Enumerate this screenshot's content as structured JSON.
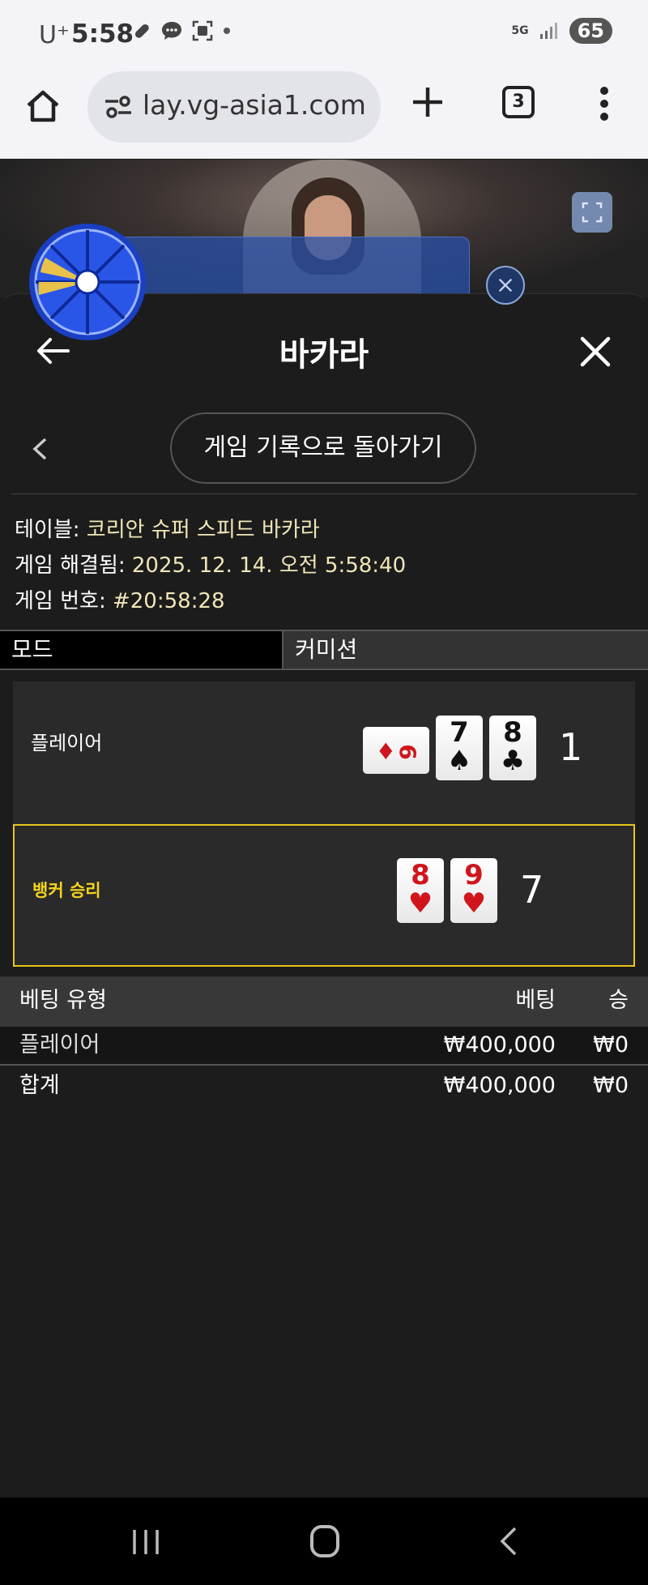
{
  "status_bar": {
    "carrier": "U⁺",
    "time": "5:58",
    "network": "5G",
    "battery": "65"
  },
  "browser": {
    "url": "lay.vg-asia1.com",
    "tab_count": "3"
  },
  "panel": {
    "title": "바카라",
    "back_to_history_label": "게임 기록으로 돌아가기",
    "info": {
      "table_label": "테이블:",
      "table_value": "코리안 슈퍼 스피드 바카라",
      "resolved_label": "게임 해결됨:",
      "resolved_value": "2025. 12. 14. 오전 5:58:40",
      "game_no_label": "게임 번호:",
      "game_no_value": "#20:58:28"
    },
    "mode_header": {
      "mode": "모드",
      "commission": "커미션"
    },
    "player_hand": {
      "label": "플레이어",
      "total": "1",
      "cards": [
        {
          "rank": "9",
          "suit": "♦",
          "color": "red",
          "sideways": true
        },
        {
          "rank": "7",
          "suit": "♠",
          "color": "black",
          "sideways": false
        },
        {
          "rank": "8",
          "suit": "♣",
          "color": "black",
          "sideways": false
        }
      ]
    },
    "banker_hand": {
      "label": "뱅커 승리",
      "total": "7",
      "cards": [
        {
          "rank": "8",
          "suit": "♥",
          "color": "red"
        },
        {
          "rank": "9",
          "suit": "♥",
          "color": "red"
        }
      ]
    },
    "bets": {
      "headers": {
        "type": "베팅 유형",
        "bet": "베팅",
        "win": "승"
      },
      "rows": [
        {
          "type": "플레이어",
          "bet": "₩400,000",
          "win": "₩0"
        }
      ],
      "total": {
        "type": "합계",
        "bet": "₩400,000",
        "win": "₩0"
      }
    }
  },
  "colors": {
    "banker_accent": "#e6c619",
    "panel_bg": "#1c1c1c",
    "info_value": "#f0e6b8"
  }
}
